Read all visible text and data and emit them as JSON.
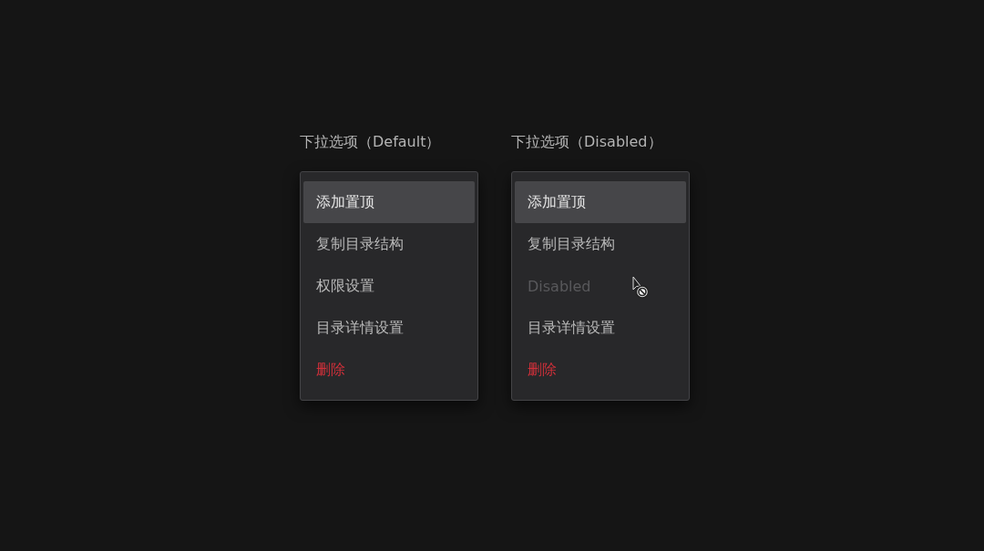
{
  "menus": [
    {
      "title": "下拉选项（Default）",
      "items": [
        {
          "label": "添加置顶",
          "kind": "normal",
          "selected": true,
          "disabled": false
        },
        {
          "label": "复制目录结构",
          "kind": "normal",
          "selected": false,
          "disabled": false
        },
        {
          "label": "权限设置",
          "kind": "normal",
          "selected": false,
          "disabled": false
        },
        {
          "label": "目录详情设置",
          "kind": "normal",
          "selected": false,
          "disabled": false
        },
        {
          "label": "删除",
          "kind": "danger",
          "selected": false,
          "disabled": false
        }
      ]
    },
    {
      "title": "下拉选项（Disabled）",
      "items": [
        {
          "label": "添加置顶",
          "kind": "normal",
          "selected": true,
          "disabled": false
        },
        {
          "label": "复制目录结构",
          "kind": "normal",
          "selected": false,
          "disabled": false
        },
        {
          "label": "Disabled",
          "kind": "normal",
          "selected": false,
          "disabled": true
        },
        {
          "label": "目录详情设置",
          "kind": "normal",
          "selected": false,
          "disabled": false
        },
        {
          "label": "删除",
          "kind": "danger",
          "selected": false,
          "disabled": false
        }
      ]
    }
  ]
}
